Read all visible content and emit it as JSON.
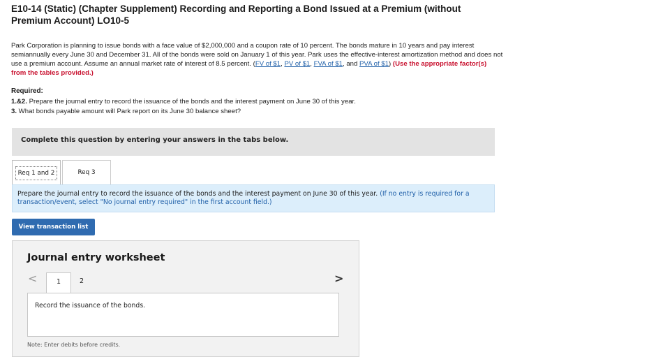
{
  "header": {
    "title_line1": "E10-14 (Static) (Chapter Supplement) Recording and Reporting a Bond Issued at a Premium (without",
    "title_line2": "Premium Account) LO10-5"
  },
  "problem": {
    "text": "Park Corporation is planning to issue bonds with a face value of $2,000,000 and a coupon rate of 10 percent. The bonds mature in 10 years and pay interest semiannually every June 30 and December 31. All of the bonds were sold on January 1 of this year. Park uses the effective-interest amortization method and does not use a premium account. Assume an annual market rate of interest of 8.5 percent. (",
    "links": [
      "FV of $1",
      "PV of $1",
      "FVA of $1",
      "PVA of $1"
    ],
    "sep1": ", ",
    "sep2": ", ",
    "sep3": ", and ",
    "close": ") ",
    "instruction": "(Use the appropriate factor(s) from the tables provided.)"
  },
  "required": {
    "heading": "Required:",
    "items": [
      {
        "num": "1.&2.",
        "text": " Prepare the journal entry to record the issuance of the bonds and the interest payment on June 30 of this year."
      },
      {
        "num": "3.",
        "text": " What bonds payable amount will Park report on its June 30 balance sheet?"
      }
    ]
  },
  "complete_banner": "Complete this question by entering your answers in the tabs below.",
  "tabs": [
    {
      "label": "Req 1 and 2",
      "active": true
    },
    {
      "label": "Req 3",
      "active": false
    }
  ],
  "instruction_panel": {
    "text": "Prepare the journal entry to record the issuance of the bonds and the interest payment on June 30 of this year. ",
    "note": "(If no entry is required for a transaction/event, select \"No journal entry required\" in the first account field.)"
  },
  "view_button": "View transaction list",
  "worksheet": {
    "title": "Journal entry worksheet",
    "prev_arrow": "<",
    "next_arrow": ">",
    "pages": [
      "1",
      "2"
    ],
    "entry_text": "Record the issuance of the bonds.",
    "note": "Note: Enter debits before credits."
  },
  "colors": {
    "link": "#1f5fa8",
    "emphasis_red": "#c8102e",
    "button_blue": "#2f6bb0",
    "panel_blue": "#dceefb"
  }
}
